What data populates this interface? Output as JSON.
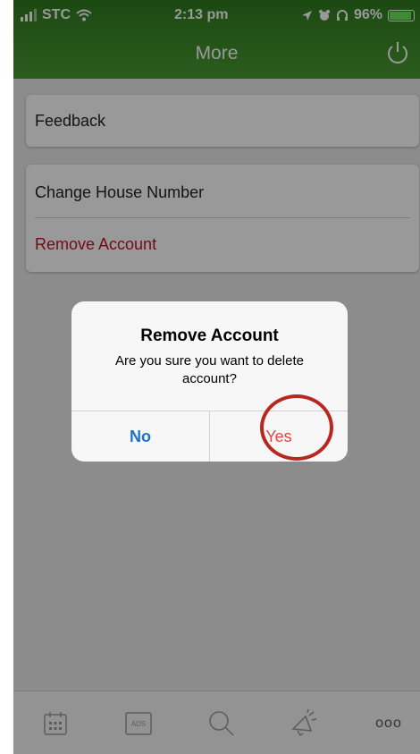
{
  "status_bar": {
    "carrier": "STC",
    "time": "2:13 pm",
    "battery": "96%",
    "battery_level": 0.96,
    "icons": [
      "signal-icon",
      "wifi-icon",
      "location-icon",
      "alarm-icon",
      "headphones-icon",
      "battery-icon"
    ]
  },
  "header": {
    "title": "More",
    "right_icon": "power-icon"
  },
  "menu": {
    "feedback": "Feedback",
    "change_house_number": "Change House Number",
    "remove_account": "Remove Account"
  },
  "dialog": {
    "title": "Remove Account",
    "message": "Are you sure you want to delete account?",
    "no_label": "No",
    "yes_label": "Yes"
  },
  "tab_bar": {
    "items": [
      "calendar-icon",
      "ads-icon",
      "search-icon",
      "announcement-icon",
      "more-icon"
    ],
    "ads_label": "ADS",
    "more_label": "ooo"
  },
  "colors": {
    "header_green": "#3f8a2a",
    "destructive_red": "#c0152a",
    "link_blue": "#1a73c9",
    "yes_red": "#e0464a",
    "highlight_circle": "#b8281e"
  }
}
